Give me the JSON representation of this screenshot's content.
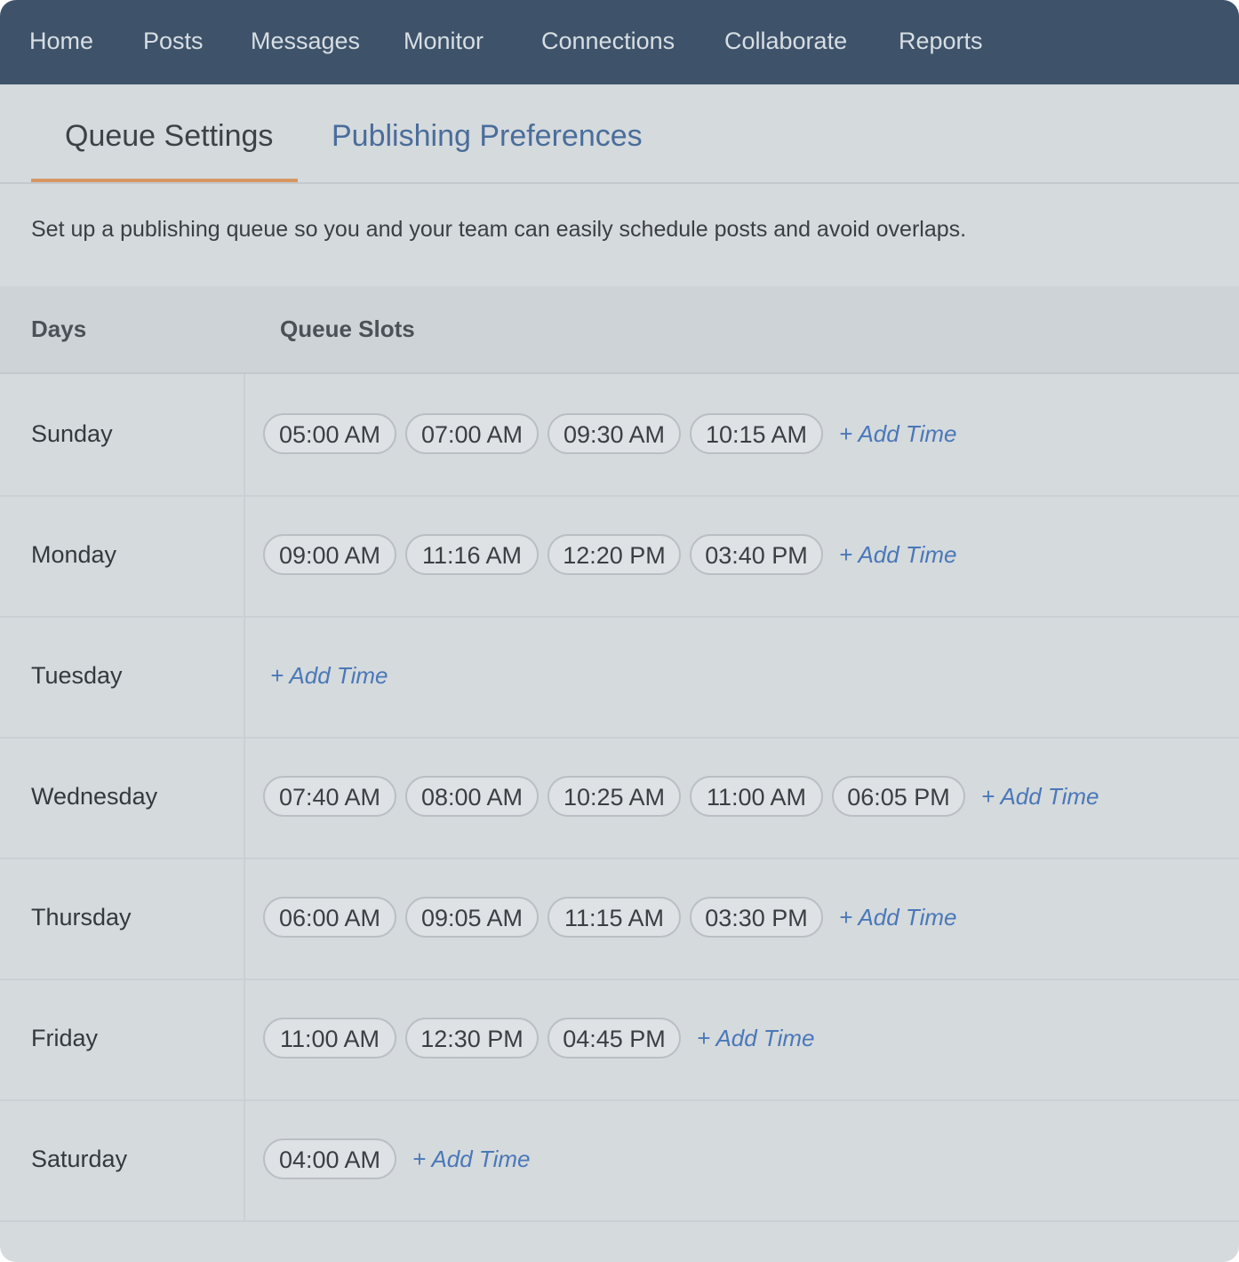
{
  "nav": {
    "items": [
      "Home",
      "Posts",
      "Messages",
      "Monitor",
      "Connections",
      "Collaborate",
      "Reports"
    ]
  },
  "tabs": {
    "active": "Queue Settings",
    "inactive": "Publishing Preferences"
  },
  "description": "Set up a publishing queue so you and your team can easily schedule posts and avoid overlaps.",
  "table": {
    "headers": {
      "days": "Days",
      "slots": "Queue Slots"
    },
    "add_time_label": "+ Add Time",
    "rows": [
      {
        "day": "Sunday",
        "slots": [
          "05:00 AM",
          "07:00 AM",
          "09:30 AM",
          "10:15 AM"
        ]
      },
      {
        "day": "Monday",
        "slots": [
          "09:00 AM",
          "11:16 AM",
          "12:20 PM",
          "03:40 PM"
        ]
      },
      {
        "day": "Tuesday",
        "slots": []
      },
      {
        "day": "Wednesday",
        "slots": [
          "07:40 AM",
          "08:00 AM",
          "10:25 AM",
          "11:00 AM",
          "06:05 PM"
        ]
      },
      {
        "day": "Thursday",
        "slots": [
          "06:00 AM",
          "09:05 AM",
          "11:15 AM",
          "03:30 PM"
        ]
      },
      {
        "day": "Friday",
        "slots": [
          "11:00 AM",
          "12:30 PM",
          "04:45 PM"
        ]
      },
      {
        "day": "Saturday",
        "slots": [
          "04:00 AM"
        ]
      }
    ]
  },
  "colors": {
    "nav_background": "#3e536a",
    "page_background": "#d5dadd",
    "active_tab_underline": "#d69663",
    "link_blue": "#4a78b8"
  }
}
